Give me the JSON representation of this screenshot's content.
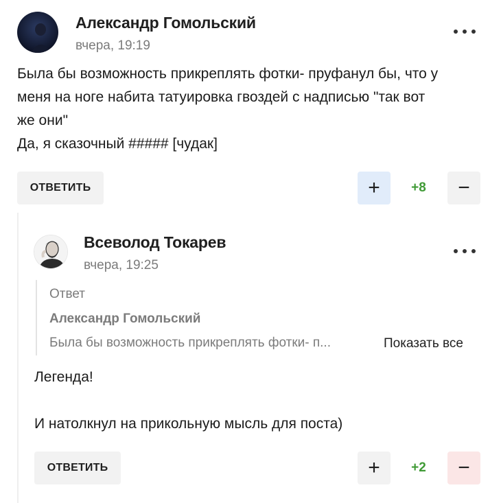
{
  "comment1": {
    "author": "Александр Гомольский",
    "time": "вчера, 19:19",
    "text_lines": [
      "Была бы возможность прикреплять фотки- пруфанул бы, что у",
      "меня на ноге набита татуировка гвоздей с надписью \"так вот",
      "же они\"",
      "Да, я сказочный ##### [чудак]"
    ],
    "reply_label": "ОТВЕТИТЬ",
    "plus_symbol": "+",
    "votes": "+8",
    "minus_symbol": "−",
    "avatar_icon": "user-avatar-icon"
  },
  "comment2": {
    "author": "Всеволод Токарев",
    "time": "вчера, 19:25",
    "quote": {
      "label": "Ответ",
      "author": "Александр Гомольский",
      "text": "Была бы возможность прикреплять фотки- п...",
      "show_all": "Показать все"
    },
    "text_lines": [
      "Легенда!",
      "",
      "И натолкнул на прикольную мысль для поста)"
    ],
    "reply_label": "ОТВЕТИТЬ",
    "plus_symbol": "+",
    "votes": "+2",
    "minus_symbol": "−",
    "avatar_icon": "user-avatar-icon"
  },
  "colors": {
    "vote_positive": "#3f9a35",
    "upvote_active_bg": "#e1ecfa",
    "downvote_active_bg": "#fbe6e6",
    "muted_text": "#7b7b7b"
  }
}
